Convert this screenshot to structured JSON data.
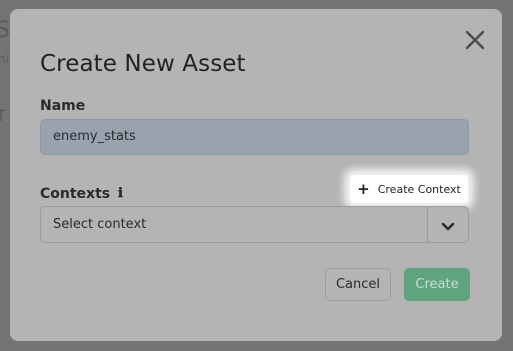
{
  "background": {
    "fragments": [
      "S",
      "ni",
      "T"
    ]
  },
  "modal": {
    "title": "Create New Asset",
    "close_icon": "close-icon",
    "name_field": {
      "label": "Name",
      "value": "enemy_stats"
    },
    "contexts": {
      "label": "Contexts",
      "info_icon": "info-icon",
      "info_glyph": "ℹ",
      "create_button_icon": "plus-icon",
      "create_button_glyph": "+",
      "create_button_label": "Create Context",
      "select_value": "Select context",
      "select_icon": "chevron-down-icon"
    },
    "buttons": {
      "cancel": "Cancel",
      "create": "Create"
    }
  },
  "colors": {
    "overlay": "#6e6e6e",
    "modal_bg": "#b4b4b4",
    "input_bg": "#9aa2b0",
    "primary": "#5fa47f"
  }
}
